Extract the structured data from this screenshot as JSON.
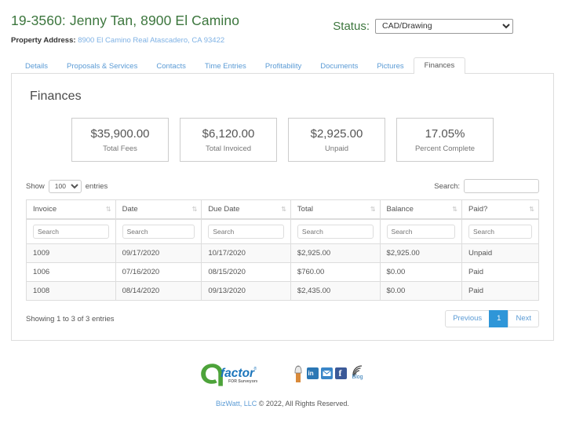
{
  "header": {
    "job_title": "19-3560: Jenny Tan, 8900 El Camino",
    "property_label": "Property Address",
    "property_separator": ":",
    "property_address": "8900 El Camino Real Atascadero, CA 93422",
    "status_label": "Status:",
    "status_value": "CAD/Drawing",
    "status_options": [
      "CAD/Drawing"
    ]
  },
  "tabs": [
    {
      "label": "Details",
      "active": false
    },
    {
      "label": "Proposals & Services",
      "active": false
    },
    {
      "label": "Contacts",
      "active": false
    },
    {
      "label": "Time Entries",
      "active": false
    },
    {
      "label": "Profitability",
      "active": false
    },
    {
      "label": "Documents",
      "active": false
    },
    {
      "label": "Pictures",
      "active": false
    },
    {
      "label": "Finances",
      "active": true
    }
  ],
  "panel": {
    "title": "Finances",
    "stats": [
      {
        "value": "$35,900.00",
        "label": "Total Fees"
      },
      {
        "value": "$6,120.00",
        "label": "Total Invoiced"
      },
      {
        "value": "$2,925.00",
        "label": "Unpaid"
      },
      {
        "value": "17.05%",
        "label": "Percent Complete"
      }
    ]
  },
  "table_controls": {
    "show_label": "Show",
    "entries_label": "entries",
    "page_length": "100",
    "page_length_options": [
      "100"
    ],
    "search_label": "Search:",
    "search_value": "",
    "column_filter_placeholder": "Search"
  },
  "table": {
    "columns": [
      "Invoice",
      "Date",
      "Due Date",
      "Total",
      "Balance",
      "Paid?"
    ],
    "rows": [
      {
        "invoice": "1009",
        "date": "09/17/2020",
        "due_date": "10/17/2020",
        "total": "$2,925.00",
        "balance": "$2,925.00",
        "paid": "Unpaid"
      },
      {
        "invoice": "1006",
        "date": "07/16/2020",
        "due_date": "08/15/2020",
        "total": "$760.00",
        "balance": "$0.00",
        "paid": "Paid"
      },
      {
        "invoice": "1008",
        "date": "08/14/2020",
        "due_date": "09/13/2020",
        "total": "$2,435.00",
        "balance": "$0.00",
        "paid": "Paid"
      }
    ]
  },
  "pagination": {
    "info": "Showing 1 to 3 of 3 entries",
    "previous": "Previous",
    "current_page": "1",
    "next": "Next"
  },
  "footer": {
    "logo_mark": "Q",
    "logo_word": "factor",
    "logo_tm": "®",
    "logo_tagline": "for Surveyors",
    "social": [
      {
        "name": "thumbs-up-icon",
        "label": ""
      },
      {
        "name": "linkedin-icon",
        "label": "in"
      },
      {
        "name": "email-icon",
        "label": ""
      },
      {
        "name": "facebook-icon",
        "label": "f"
      },
      {
        "name": "blog-rss-icon",
        "label": "Blog"
      }
    ],
    "copyright_link": "BizWatt, LLC",
    "copyright_rest": " © 2022, All Rights Reserved."
  },
  "colors": {
    "green": "#3c763d",
    "link_blue": "#5b9bd5",
    "accent_blue": "#2f96d8",
    "logo_green": "#4da33a",
    "logo_blue": "#1b75bb"
  }
}
